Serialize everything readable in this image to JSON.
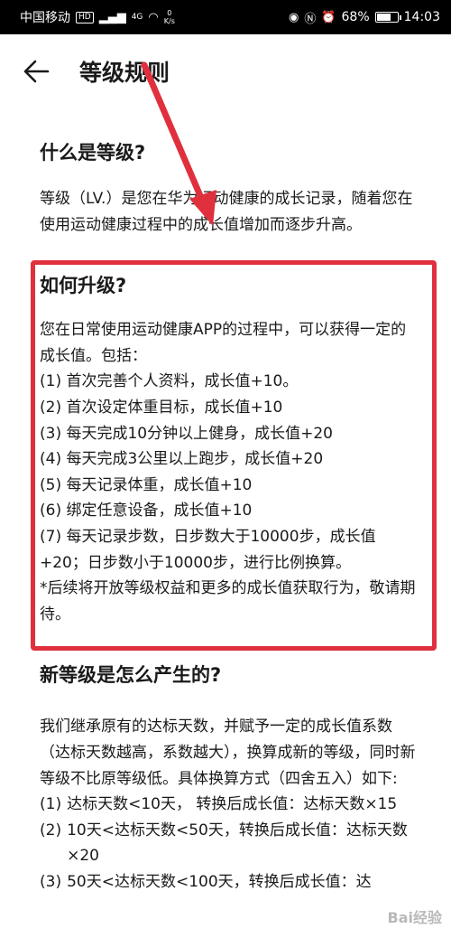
{
  "status_bar": {
    "carrier": "中国移动",
    "hd_badge": "HD",
    "net_type": "4G",
    "speed_value": "0",
    "speed_unit": "K/s",
    "battery_percent": "68%",
    "battery_level": 0.68,
    "time": "14:03"
  },
  "header": {
    "title": "等级规则"
  },
  "sections": {
    "what": {
      "title": "什么是等级?",
      "body": "等级（LV.）是您在华为运动健康的成长记录，随着您在使用运动健康过程中的成长值增加而逐步升高。"
    },
    "upgrade": {
      "title": "如何升级?",
      "intro": "您在日常使用运动健康APP的过程中，可以获得一定的成长值。包括：",
      "items": [
        "(1) 首次完善个人资料，成长值+10。",
        "(2) 首次设定体重目标，成长值+10",
        "(3) 每天完成10分钟以上健身，成长值+20",
        "(4) 每天完成3公里以上跑步，成长值+20",
        "(5) 每天记录体重，成长值+10",
        "(6) 绑定任意设备，成长值+10",
        "(7) 每天记录步数，日步数大于10000步，成长值+20；日步数小于10000步，进行比例换算。"
      ],
      "note": "*后续将开放等级权益和更多的成长值获取行为，敬请期待。"
    },
    "new_level": {
      "title": "新等级是怎么产生的?",
      "intro": "我们继承原有的达标天数，并赋予一定的成长值系数（达标天数越高，系数越大），换算成新的等级，同时新等级不比原等级低。具体换算方式（四舍五入）如下:",
      "items": [
        {
          "num": "(1)",
          "text": "达标天数<10天， 转换后成长值：达标天数×15"
        },
        {
          "num": "(2)",
          "text": "10天<达标天数<50天，转换后成长值：达标天数×20"
        },
        {
          "num": "(3)",
          "text": "50天<达标天数<100天，转换后成长值：达"
        }
      ]
    }
  },
  "watermark": "Bai经验",
  "annotation_color": "#e0303e"
}
